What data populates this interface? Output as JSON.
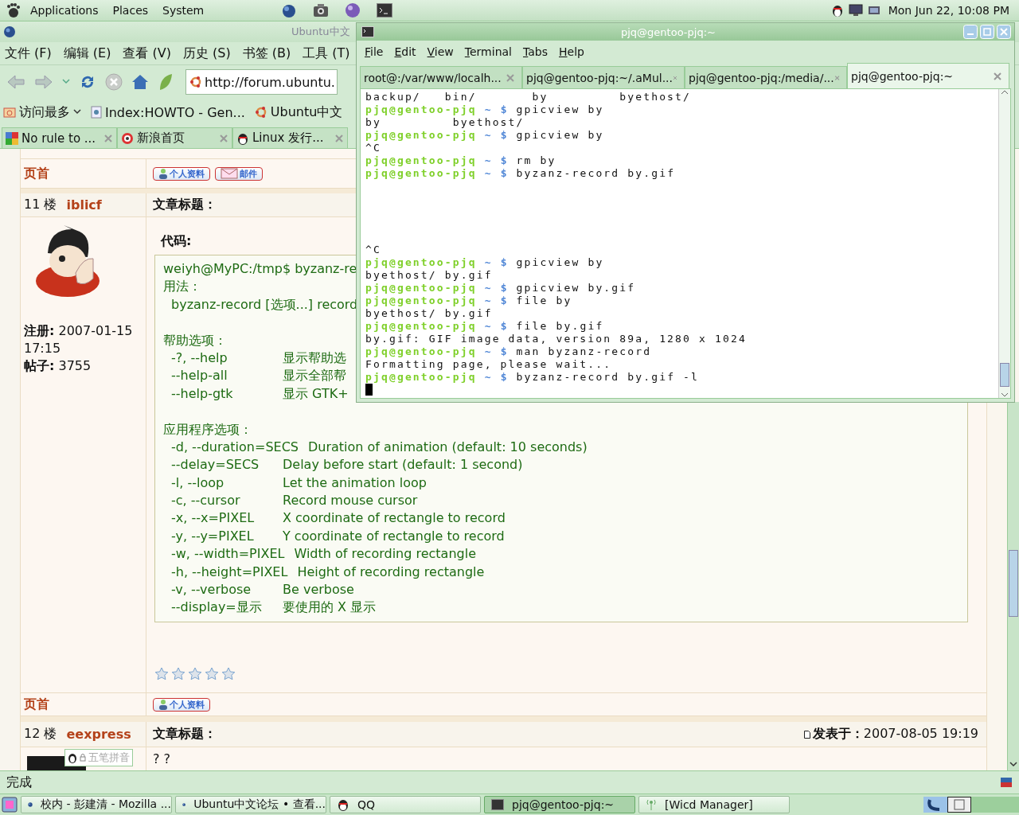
{
  "top_panel": {
    "menus": [
      "Applications",
      "Places",
      "System"
    ],
    "clock": "Mon Jun 22, 10:08 PM"
  },
  "browser": {
    "title": "Ubuntu中文",
    "menus": [
      "文件 (F)",
      "编辑 (E)",
      "查看 (V)",
      "历史 (S)",
      "书签 (B)",
      "工具 (T)"
    ],
    "url": "http://forum.ubuntu.",
    "bookmarks": [
      {
        "label": "访问最多",
        "kind": "folder"
      },
      {
        "label": "Index:HOWTO - Gen...",
        "kind": "page"
      },
      {
        "label": "Ubuntu中文",
        "kind": "ubuntu"
      }
    ],
    "tabs": [
      {
        "label": "No rule to ...",
        "kind": "google",
        "selected": false
      },
      {
        "label": "新浪首页",
        "kind": "sina",
        "selected": false
      },
      {
        "label": "Linux 发行...",
        "kind": "qq",
        "selected": false
      }
    ],
    "status": "完成"
  },
  "forum": {
    "top_footer": {
      "link": "页首",
      "buttons": [
        {
          "label": "个人资料",
          "kind": "profile"
        },
        {
          "label": "邮件",
          "kind": "mail"
        }
      ]
    },
    "posts": [
      {
        "floor": "11 楼",
        "author": "iblicf",
        "subject_label": "文章标题：",
        "registered_label": "注册:",
        "registered": "2007-01-15 17:15",
        "posts_label": "帖子:",
        "posts": "3755",
        "code_label": "代码:",
        "code_lines": [
          {
            "kind": "text",
            "text": "weiyh@MyPC:/tmp$ byzanz-re"
          },
          {
            "kind": "text",
            "text": "用法："
          },
          {
            "kind": "indented",
            "text": "byzanz-record [选项...] record"
          },
          {
            "kind": "blank"
          },
          {
            "kind": "text",
            "text": "帮助选项："
          },
          {
            "kind": "option",
            "option": "-?, --help",
            "desc": "显示帮助选"
          },
          {
            "kind": "option",
            "option": "--help-all",
            "desc": "显示全部帮"
          },
          {
            "kind": "option",
            "option": "--help-gtk",
            "desc": "显示 GTK+"
          },
          {
            "kind": "blank"
          },
          {
            "kind": "text",
            "text": "应用程序选项："
          },
          {
            "kind": "option",
            "option": "-d, --duration=SECS",
            "desc": "Duration of animation (default: 10 seconds)"
          },
          {
            "kind": "option",
            "option": "--delay=SECS",
            "desc": "Delay before start (default: 1 second)"
          },
          {
            "kind": "option",
            "option": "-l, --loop",
            "desc": "Let the animation loop"
          },
          {
            "kind": "option",
            "option": "-c, --cursor",
            "desc": "Record mouse cursor"
          },
          {
            "kind": "option",
            "option": "-x, --x=PIXEL",
            "desc": "X coordinate of rectangle to record"
          },
          {
            "kind": "option",
            "option": "-y, --y=PIXEL",
            "desc": "Y coordinate of rectangle to record"
          },
          {
            "kind": "option",
            "option": "-w, --width=PIXEL",
            "desc": "Width of recording rectangle"
          },
          {
            "kind": "option",
            "option": "-h, --height=PIXEL",
            "desc": "Height of recording rectangle"
          },
          {
            "kind": "option",
            "option": "-v, --verbose",
            "desc": "Be verbose"
          },
          {
            "kind": "option",
            "option": "--display=显示",
            "desc": "要使用的 X 显示"
          }
        ],
        "stars": 0,
        "footer": {
          "link": "页首",
          "buttons": [
            {
              "label": "个人资料",
              "kind": "profile"
            }
          ]
        }
      },
      {
        "floor": "12 楼",
        "author": "eexpress",
        "subject_label": "文章标题：",
        "posted_label": "发表于：",
        "posted": "2007-08-05 19:19",
        "body": "? ?"
      }
    ],
    "ime": {
      "label": "五笔拼音"
    }
  },
  "terminal": {
    "title": "pjq@gentoo-pjq:~",
    "menus": [
      "File",
      "Edit",
      "View",
      "Terminal",
      "Tabs",
      "Help"
    ],
    "tabs": [
      {
        "label": "root@:/var/www/localh...",
        "selected": false
      },
      {
        "label": "pjq@gentoo-pjq:~/.aMul...",
        "selected": false
      },
      {
        "label": "pjq@gentoo-pjq:/media/...",
        "selected": false
      },
      {
        "label": "pjq@gentoo-pjq:~",
        "selected": true
      }
    ],
    "lines": [
      {
        "kind": "output",
        "text": "backup/   bin/       by         byethost/"
      },
      {
        "kind": "prompt",
        "user": "pjq@gentoo-pjq",
        "dir": "~",
        "sign": "$",
        "command": "gpicview by"
      },
      {
        "kind": "output",
        "text": "by         byethost/"
      },
      {
        "kind": "prompt",
        "user": "pjq@gentoo-pjq",
        "dir": "~",
        "sign": "$",
        "command": "gpicview by"
      },
      {
        "kind": "output",
        "text": "^C"
      },
      {
        "kind": "prompt",
        "user": "pjq@gentoo-pjq",
        "dir": "~",
        "sign": "$",
        "command": "rm by"
      },
      {
        "kind": "prompt",
        "user": "pjq@gentoo-pjq",
        "dir": "~",
        "sign": "$",
        "command": "byzanz-record by.gif"
      },
      {
        "kind": "blank"
      },
      {
        "kind": "blank"
      },
      {
        "kind": "blank"
      },
      {
        "kind": "blank"
      },
      {
        "kind": "blank"
      },
      {
        "kind": "output",
        "text": "^C"
      },
      {
        "kind": "prompt",
        "user": "pjq@gentoo-pjq",
        "dir": "~",
        "sign": "$",
        "command": "gpicview by"
      },
      {
        "kind": "output",
        "text": "byethost/ by.gif"
      },
      {
        "kind": "prompt",
        "user": "pjq@gentoo-pjq",
        "dir": "~",
        "sign": "$",
        "command": "gpicview by.gif"
      },
      {
        "kind": "prompt",
        "user": "pjq@gentoo-pjq",
        "dir": "~",
        "sign": "$",
        "command": "file by"
      },
      {
        "kind": "output",
        "text": "byethost/ by.gif"
      },
      {
        "kind": "prompt",
        "user": "pjq@gentoo-pjq",
        "dir": "~",
        "sign": "$",
        "command": "file by.gif"
      },
      {
        "kind": "output",
        "text": "by.gif: GIF image data, version 89a, 1280 x 1024"
      },
      {
        "kind": "prompt",
        "user": "pjq@gentoo-pjq",
        "dir": "~",
        "sign": "$",
        "command": "man byzanz-record"
      },
      {
        "kind": "output",
        "text": "Formatting page, please wait..."
      },
      {
        "kind": "prompt",
        "user": "pjq@gentoo-pjq",
        "dir": "~",
        "sign": "$",
        "command": "byzanz-record by.gif -l"
      },
      {
        "kind": "cursor"
      }
    ]
  },
  "taskbar": {
    "tasks": [
      {
        "label": "校内 - 彭建清 - Mozilla ...",
        "kind": "browser",
        "selected": false
      },
      {
        "label": "Ubuntu中文论坛 • 查看...",
        "kind": "browser",
        "selected": false
      },
      {
        "label": "QQ",
        "kind": "qq",
        "selected": false
      },
      {
        "label": "pjq@gentoo-pjq:~",
        "kind": "terminal",
        "selected": true
      },
      {
        "label": "[Wicd Manager]",
        "kind": "wifi",
        "selected": false
      }
    ]
  }
}
